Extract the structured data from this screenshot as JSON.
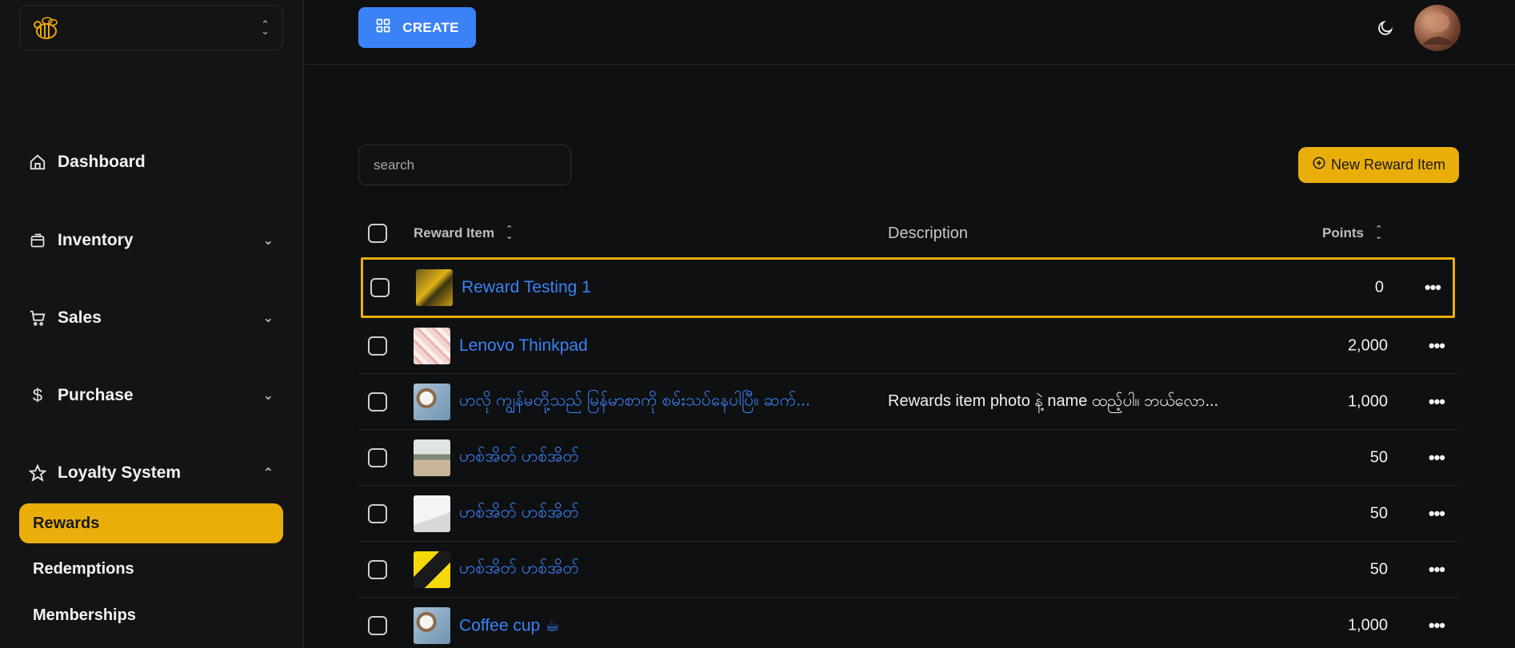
{
  "sidebar": {
    "nav": [
      {
        "label": "Dashboard",
        "icon": "home-icon",
        "chevron": ""
      },
      {
        "label": "Inventory",
        "icon": "box-icon",
        "chevron": "⌄"
      },
      {
        "label": "Sales",
        "icon": "cart-icon",
        "chevron": "⌄"
      },
      {
        "label": "Purchase",
        "icon": "dollar-icon",
        "chevron": "⌄"
      },
      {
        "label": "Loyalty System",
        "icon": "star-icon",
        "chevron": "⌃"
      }
    ],
    "sub": [
      {
        "label": "Rewards",
        "active": true
      },
      {
        "label": "Redemptions",
        "active": false
      },
      {
        "label": "Memberships",
        "active": false
      }
    ]
  },
  "topbar": {
    "create_label": "CREATE"
  },
  "toolbar": {
    "search_placeholder": "search",
    "new_label": "New Reward Item"
  },
  "table": {
    "columns": {
      "item": "Reward Item",
      "description": "Description",
      "points": "Points"
    },
    "rows": [
      {
        "name": "Reward Testing 1",
        "description": "",
        "points": "0",
        "selected": true
      },
      {
        "name": "Lenovo Thinkpad",
        "description": "",
        "points": "2,000",
        "selected": false
      },
      {
        "name": "ဟလို ကျွန်မတို့သည် မြန်မာစာကို စမ်းသပ်နေပါပြီ။ ဆက်...",
        "description": "Rewards item photo နဲ့ name ထည့်ပါ။ ဘယ်လော...",
        "points": "1,000",
        "selected": false
      },
      {
        "name": "ဟစ်အိတ် ဟစ်အိတ်",
        "description": "",
        "points": "50",
        "selected": false
      },
      {
        "name": "ဟစ်အိတ် ဟစ်အိတ်",
        "description": "",
        "points": "50",
        "selected": false
      },
      {
        "name": "ဟစ်အိတ် ဟစ်အိတ်",
        "description": "",
        "points": "50",
        "selected": false
      },
      {
        "name": "Coffee cup ☕",
        "description": "",
        "points": "1,000",
        "selected": false
      }
    ]
  },
  "colors": {
    "accent": "#eaae0b",
    "link": "#3b82f6",
    "background": "#0f1011"
  }
}
